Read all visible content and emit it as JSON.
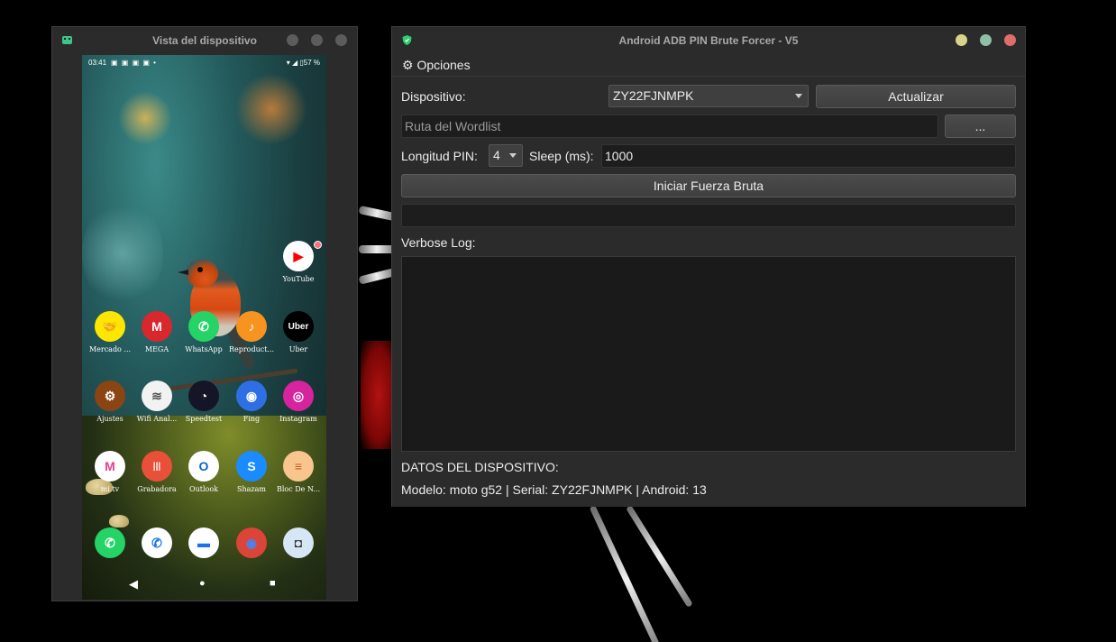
{
  "device_window": {
    "title": "Vista del dispositivo",
    "status_bar": {
      "time": "03:41",
      "notifications": "▣ ▣ ▣ ▣ •",
      "system": "▾ ◢ ▯57 %"
    },
    "apps": [
      {
        "label": "YouTube",
        "glyph": "▶",
        "color": "#ffffff",
        "glyph_color": "#ff0000",
        "badge": true
      },
      {
        "label": "Mercado ...",
        "glyph": "🤝",
        "color": "#ffe600",
        "glyph_color": "#2d3277"
      },
      {
        "label": "MEGA",
        "glyph": "M",
        "color": "#d9272e",
        "glyph_color": "#ffffff"
      },
      {
        "label": "WhatsApp",
        "glyph": "✆",
        "color": "#25d366",
        "glyph_color": "#ffffff"
      },
      {
        "label": "Reproduct...",
        "glyph": "♪",
        "color": "#f7931e",
        "glyph_color": "#ffffff"
      },
      {
        "label": "Uber",
        "glyph": "Uber",
        "color": "#000000",
        "glyph_color": "#ffffff"
      },
      {
        "label": "Ajustes",
        "glyph": "⚙",
        "color": "#8b4513",
        "glyph_color": "#ffffff"
      },
      {
        "label": "Wifi Anal...",
        "glyph": "≋",
        "color": "#f2f2f2",
        "glyph_color": "#555555"
      },
      {
        "label": "Speedtest",
        "glyph": "◔",
        "color": "#141526",
        "glyph_color": "#ffffff"
      },
      {
        "label": "Fing",
        "glyph": "◉",
        "color": "#2f6fe4",
        "glyph_color": "#ffffff"
      },
      {
        "label": "Instagram",
        "glyph": "◎",
        "color": "#d6249f",
        "glyph_color": "#ffffff"
      },
      {
        "label": "mi.tv",
        "glyph": "M",
        "color": "#ffffff",
        "glyph_color": "#e53e8b"
      },
      {
        "label": "Grabadora",
        "glyph": "|||",
        "color": "#e8503a",
        "glyph_color": "#ffffff"
      },
      {
        "label": "Outlook",
        "glyph": "O",
        "color": "#ffffff",
        "glyph_color": "#0a64d0"
      },
      {
        "label": "Shazam",
        "glyph": "S",
        "color": "#1a8cff",
        "glyph_color": "#ffffff"
      },
      {
        "label": "Bloc De N...",
        "glyph": "≡",
        "color": "#f9c58f",
        "glyph_color": "#b5651d"
      }
    ],
    "dock": [
      {
        "name": "whatsapp-dock",
        "glyph": "✆",
        "color": "#25d366",
        "glyph_color": "#ffffff"
      },
      {
        "name": "phone",
        "glyph": "✆",
        "color": "#ffffff",
        "glyph_color": "#1a73e8"
      },
      {
        "name": "messages",
        "glyph": "▬",
        "color": "#ffffff",
        "glyph_color": "#1a73e8"
      },
      {
        "name": "chrome",
        "glyph": "◉",
        "color": "#db4437",
        "glyph_color": "#4285f4"
      },
      {
        "name": "camera",
        "glyph": "◘",
        "color": "#d7e6f5",
        "glyph_color": "#333333"
      }
    ],
    "nav": {
      "back": "◀",
      "home": "●",
      "recents": "■"
    }
  },
  "main_window": {
    "title": "Android ADB PIN Brute Forcer - V5",
    "menu": {
      "options": "⚙ Opciones"
    },
    "device_label": "Dispositivo:",
    "device_selected": "ZY22FJNMPK",
    "refresh_button": "Actualizar",
    "wordlist_placeholder": "Ruta del Wordlist",
    "browse_button": "...",
    "pin_length_label": "Longitud PIN:",
    "pin_length_value": "4",
    "sleep_label": "Sleep (ms):",
    "sleep_value": "1000",
    "start_button": "Iniciar Fuerza Bruta",
    "progress_text": "",
    "verbose_label": "Verbose Log:",
    "log_text": "",
    "device_data_header": "DATOS DEL DISPOSITIVO:",
    "device_data": "Modelo: moto g52 | Serial: ZY22FJNMPK | Android: 13",
    "window_buttons": {
      "minimize": "#d9d38a",
      "maximize": "#8fbfa7",
      "close": "#e06c6c"
    }
  }
}
